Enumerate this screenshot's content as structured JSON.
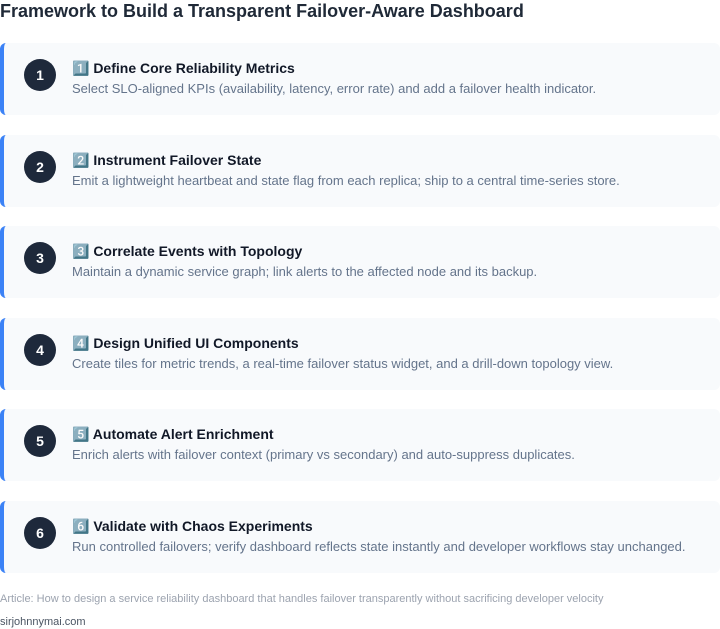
{
  "page": {
    "title": "Framework to Build a Transparent Failover-Aware Dashboard"
  },
  "theme": {
    "accent": "#3b82f6",
    "badge_bg": "#1e293b",
    "card_bg": "#f8fafc"
  },
  "steps": [
    {
      "number": "1",
      "heading": "1️⃣ Define Core Reliability Metrics",
      "description": "Select SLO-aligned KPIs (availability, latency, error rate) and add a failover health indicator."
    },
    {
      "number": "2",
      "heading": "2️⃣ Instrument Failover State",
      "description": "Emit a lightweight heartbeat and state flag from each replica; ship to a central time-series store."
    },
    {
      "number": "3",
      "heading": "3️⃣ Correlate Events with Topology",
      "description": "Maintain a dynamic service graph; link alerts to the affected node and its backup."
    },
    {
      "number": "4",
      "heading": "4️⃣ Design Unified UI Components",
      "description": "Create tiles for metric trends, a real-time failover status widget, and a drill-down topology view."
    },
    {
      "number": "5",
      "heading": "5️⃣ Automate Alert Enrichment",
      "description": "Enrich alerts with failover context (primary vs secondary) and auto-suppress duplicates."
    },
    {
      "number": "6",
      "heading": "6️⃣ Validate with Chaos Experiments",
      "description": "Run controlled failovers; verify dashboard reflects state instantly and developer workflows stay unchanged."
    }
  ],
  "footer": {
    "article": "Article: How to design a service reliability dashboard that handles failover transparently without sacrificing developer velocity",
    "site": "sirjohnnymai.com"
  }
}
